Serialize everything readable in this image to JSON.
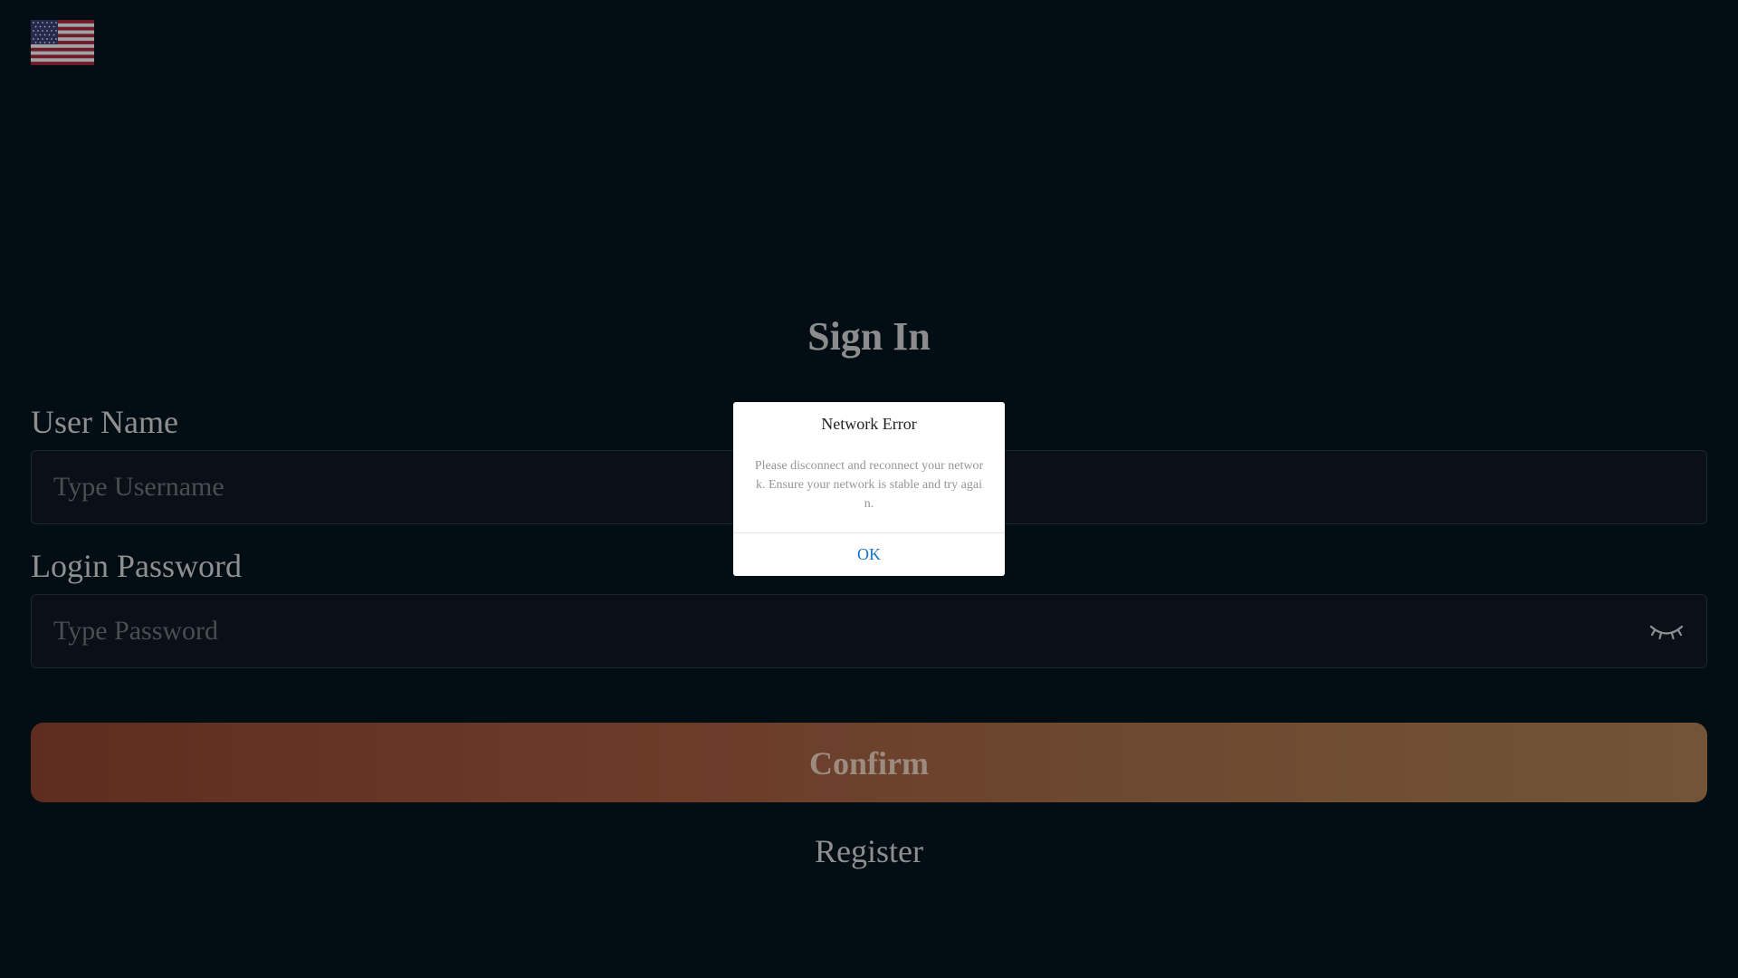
{
  "header": {
    "language_flag_icon": "us-flag-icon"
  },
  "form": {
    "title": "Sign In",
    "username": {
      "label": "User Name",
      "placeholder": "Type Username",
      "value": ""
    },
    "password": {
      "label": "Login Password",
      "placeholder": "Type Password",
      "value": "",
      "toggle_icon": "eye-closed-icon"
    },
    "confirm_label": "Confirm",
    "register_label": "Register"
  },
  "dialog": {
    "title": "Network Error",
    "message": "Please disconnect and reconnect your network. Ensure your network is stable and try again.",
    "ok_label": "OK"
  },
  "colors": {
    "background": "#020d14",
    "button_gradient_start": "#5e2d1f",
    "button_gradient_end": "#735436",
    "dialog_ok": "#1a73c8"
  }
}
